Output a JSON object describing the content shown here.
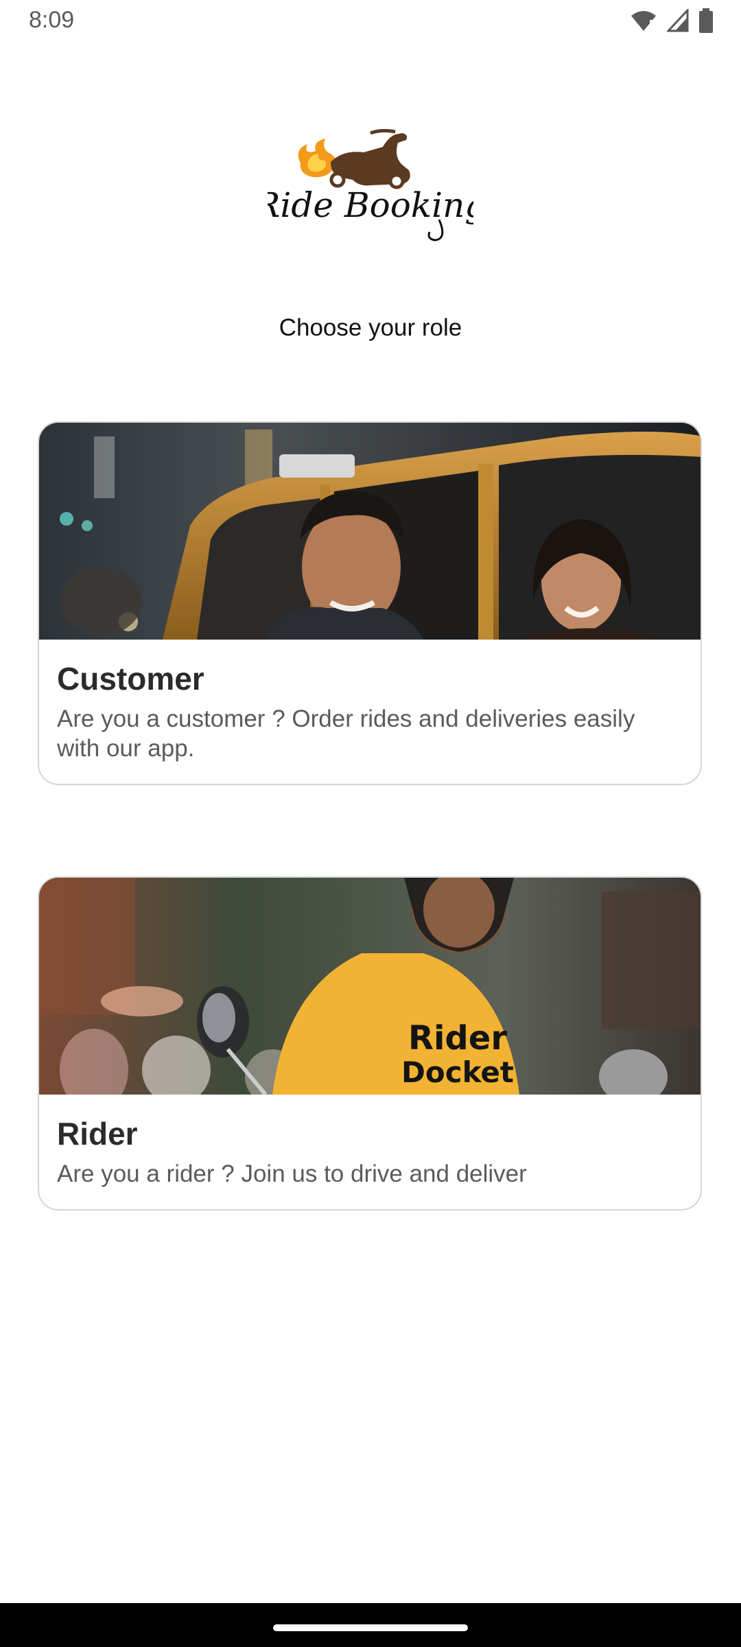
{
  "status_bar": {
    "time": "8:09",
    "icons": [
      "wifi-alert-icon",
      "cellular-signal-icon",
      "battery-icon"
    ]
  },
  "logo": {
    "text": "Ride Booking",
    "icon": "scooter-flame-logo"
  },
  "heading": "Choose your role",
  "cards": {
    "customer": {
      "title": "Customer",
      "description": "Are you a customer ? Order rides and deliveries easily with our app.",
      "image": "customers-in-taxi-photo"
    },
    "rider": {
      "title": "Rider",
      "description": "Are you a rider ? Join us to drive and deliver",
      "image": "rider-on-scooter-photo",
      "shirt_text": "Rider Docket"
    }
  },
  "colors": {
    "logo_brown": "#5b3a22",
    "flame_orange": "#f39a1a",
    "shirt_yellow": "#f2b233",
    "taxi_yellow": "#c8902e"
  }
}
